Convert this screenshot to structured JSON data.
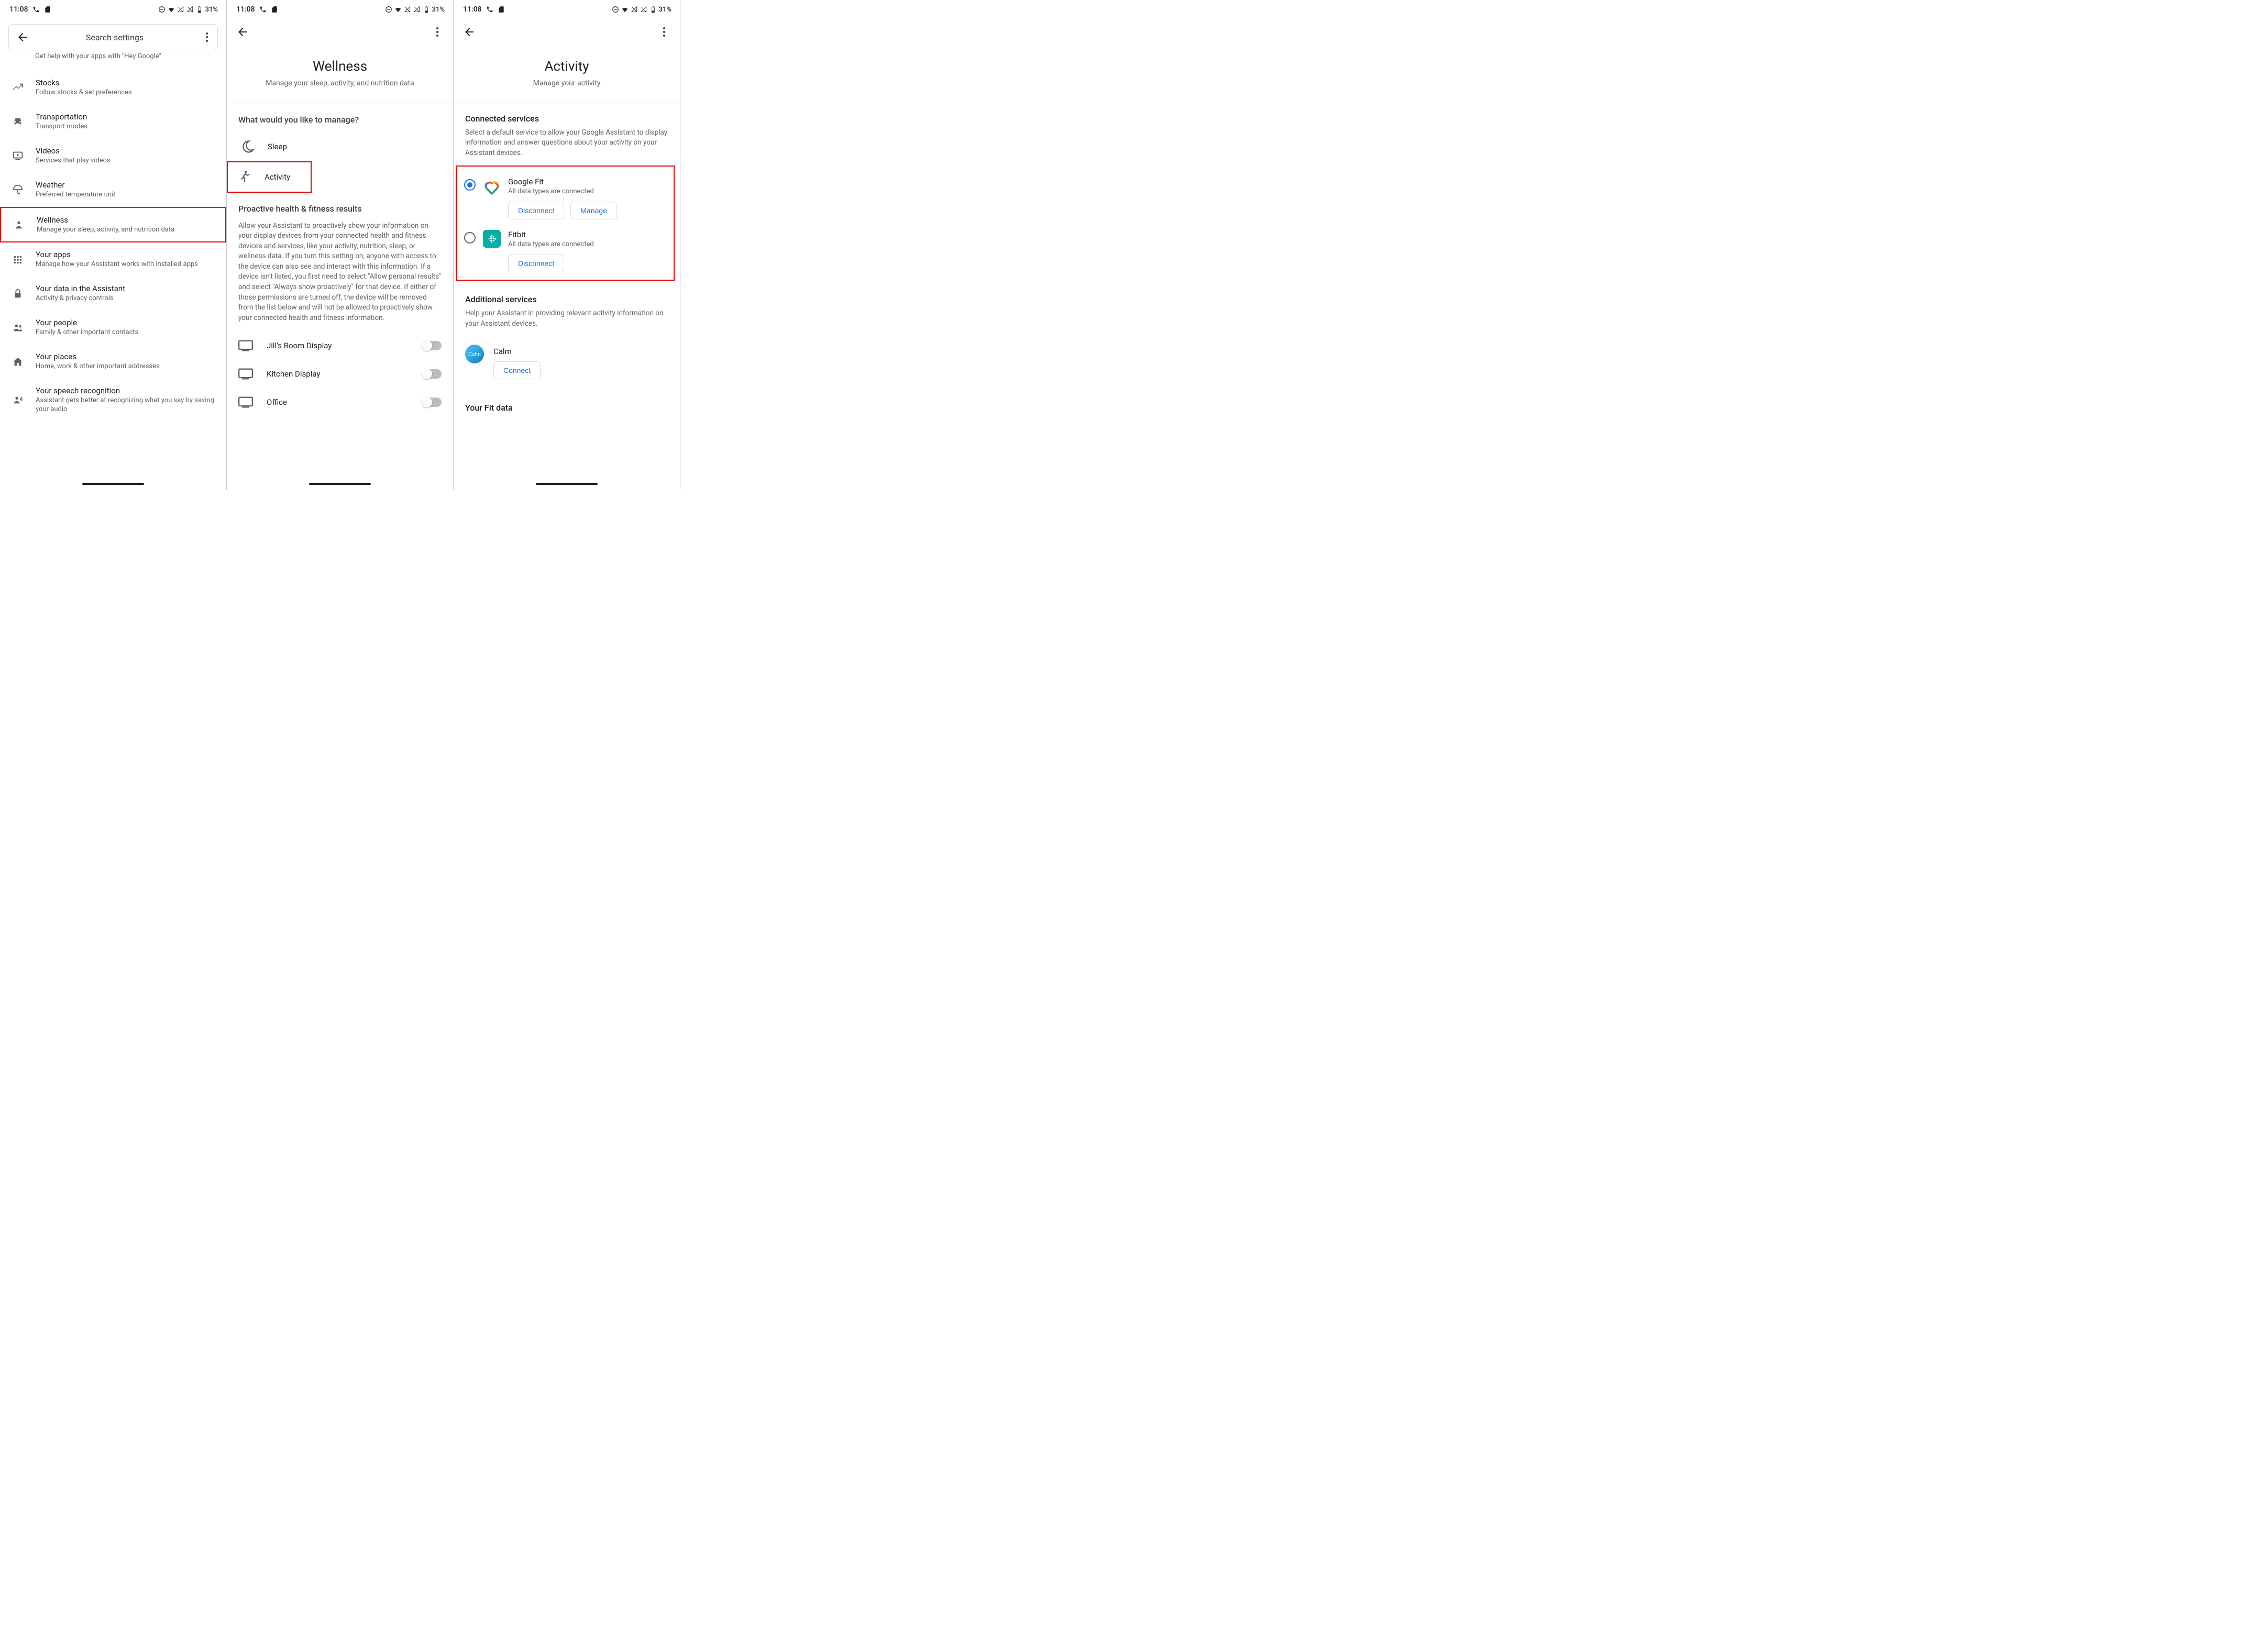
{
  "statusbar": {
    "time": "11:08",
    "battery": "31%"
  },
  "screen1": {
    "search_placeholder": "Search settings",
    "cut_text": "Get help with your apps with \"Hey Google\"",
    "items": [
      {
        "title": "Stocks",
        "sub": "Follow stocks & set preferences"
      },
      {
        "title": "Transportation",
        "sub": "Transport modes"
      },
      {
        "title": "Videos",
        "sub": "Services that play videos"
      },
      {
        "title": "Weather",
        "sub": "Preferred temperature unit"
      },
      {
        "title": "Wellness",
        "sub": "Manage your sleep, activity, and nutrition data"
      },
      {
        "title": "Your apps",
        "sub": "Manage how your Assistant works with installed apps"
      },
      {
        "title": "Your data in the Assistant",
        "sub": "Activity & privacy controls"
      },
      {
        "title": "Your people",
        "sub": "Family & other important contacts"
      },
      {
        "title": "Your places",
        "sub": "Home, work & other important addresses"
      },
      {
        "title": "Your speech recognition",
        "sub": "Assistant gets better at recognizing what you say by saving your audio"
      }
    ]
  },
  "screen2": {
    "title": "Wellness",
    "subtitle": "Manage your sleep, activity, and nutrition data",
    "question": "What would you like to manage?",
    "rows": {
      "sleep": "Sleep",
      "activity": "Activity"
    },
    "proactive_header": "Proactive health & fitness results",
    "proactive_body": "Allow your Assistant to proactively show your information on your display devices from your connected health and fitness devices and services, like your activity, nutrition, sleep, or wellness data. If you turn this setting on, anyone with access to the device can also see and interact with this information. If a device isn't listed, you first need to select \"Allow personal results\" and select \"Always show proactively\" for that device. If either of those permissions are turned off, the device will be removed from the list below and will not be allowed to proactively show your connected health and fitness information.",
    "devices": [
      "Jill's Room Display",
      "Kitchen Display",
      "Office"
    ]
  },
  "screen3": {
    "title": "Activity",
    "subtitle": "Manage your activity",
    "connected_header": "Connected services",
    "connected_body": "Select a default service to allow your Google Assistant to display information and answer questions about your activity on your Assistant devices.",
    "services": [
      {
        "name": "Google Fit",
        "sub": "All data types are connected",
        "btn1": "Disconnect",
        "btn2": "Manage",
        "selected": true
      },
      {
        "name": "Fitbit",
        "sub": "All data types are connected",
        "btn1": "Disconnect",
        "selected": false
      }
    ],
    "additional_header": "Additional services",
    "additional_body": "Help your Assistant in providing relevant activity information on your Assistant devices.",
    "calm": {
      "name": "Calm",
      "btn": "Connect"
    },
    "fit_data_header": "Your Fit data"
  }
}
